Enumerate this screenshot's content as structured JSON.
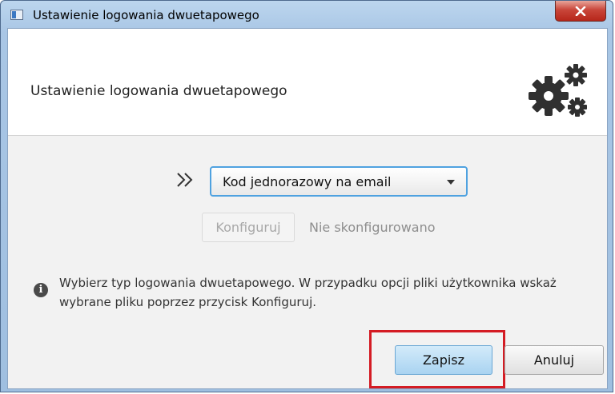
{
  "window": {
    "title": "Ustawienie logowania dwuetapowego",
    "close_icon": "close-x-icon",
    "app_icon": "window-app-icon"
  },
  "header": {
    "title": "Ustawienie logowania dwuetapowego",
    "icon": "gears-icon"
  },
  "method": {
    "arrows_icon": "double-chevron-right-icon",
    "selected": "Kod jednorazowy na email"
  },
  "configure": {
    "button_label": "Konfiguruj",
    "status": "Nie skonfigurowano"
  },
  "info": {
    "icon": "info-icon",
    "text": "Wybierz typ  logowania dwuetapowego. W przypadku opcji  pliki użytkownika wskaż wybrane pliku poprzez przycisk Konfiguruj."
  },
  "actions": {
    "save_label": "Zapisz",
    "cancel_label": "Anuluj"
  },
  "colors": {
    "highlight": "#d41c24",
    "select_focus": "#4fa2e0",
    "save_fill": "#a9d3f1"
  }
}
